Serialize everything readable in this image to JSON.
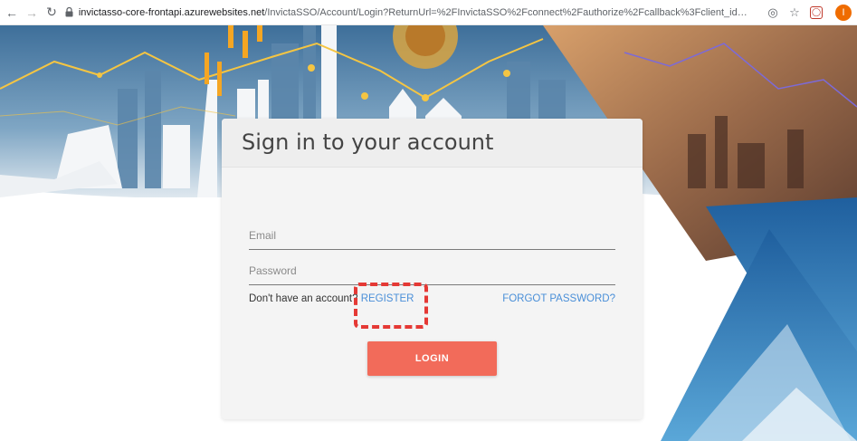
{
  "browser": {
    "url_host": "invictasso-core-frontapi.azurewebsites.net",
    "url_path": "/InvictaSSO/Account/Login?ReturnUrl=%2FInvictaSSO%2Fconnect%2Fauthorize%2Fcallback%3Fclient_id%3D...",
    "profile_initial": "I",
    "icons": {
      "back": "back-arrow-icon",
      "forward": "forward-arrow-icon",
      "reload": "reload-icon",
      "lock": "lock-icon",
      "location": "location-icon",
      "bookmark": "star-icon",
      "extension": "extension-icon"
    }
  },
  "login": {
    "title": "Sign in to your account",
    "email_placeholder": "Email",
    "password_placeholder": "Password",
    "register_prompt": "Don't have an account?",
    "register_link": "REGISTER",
    "forgot_link": "FORGOT PASSWORD?",
    "login_button": "LOGIN"
  },
  "colors": {
    "accent": "#f26b5a",
    "link": "#4a8fd8",
    "highlight": "#e53935",
    "avatar": "#ef6c00"
  }
}
